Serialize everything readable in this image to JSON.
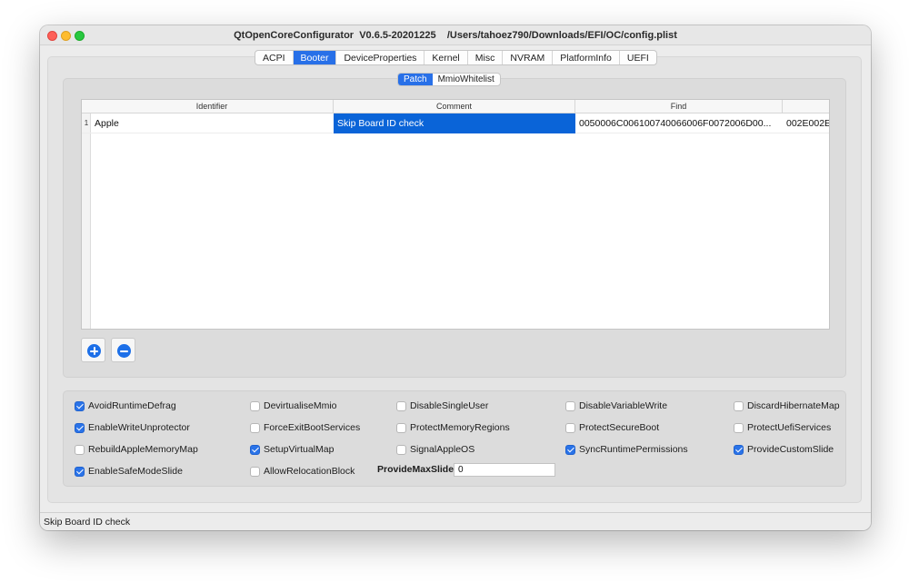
{
  "window": {
    "title": "QtOpenCoreConfigurator  V0.6.5-20201225    /Users/tahoez790/Downloads/EFI/OC/config.plist"
  },
  "tabs": [
    "ACPI",
    "Booter",
    "DeviceProperties",
    "Kernel",
    "Misc",
    "NVRAM",
    "PlatformInfo",
    "UEFI"
  ],
  "active_tab": "Booter",
  "subtabs": [
    "Patch",
    "MmioWhitelist"
  ],
  "active_subtab": "Patch",
  "table": {
    "columns": [
      "Identifier",
      "Comment",
      "Find",
      ""
    ],
    "rows": [
      {
        "num": "1",
        "identifier": "Apple",
        "comment": "Skip Board ID check",
        "find": "0050006C006100740066006F0072006D00...",
        "extra": "002E002E"
      }
    ]
  },
  "buttons": {
    "add_icon": "plus-circle-icon",
    "remove_icon": "minus-circle-icon"
  },
  "checkboxes": [
    {
      "label": "AvoidRuntimeDefrag",
      "checked": true
    },
    {
      "label": "DevirtualiseMmio",
      "checked": false
    },
    {
      "label": "DisableSingleUser",
      "checked": false
    },
    {
      "label": "DisableVariableWrite",
      "checked": false
    },
    {
      "label": "DiscardHibernateMap",
      "checked": false
    },
    {
      "label": "EnableWriteUnprotector",
      "checked": true
    },
    {
      "label": "ForceExitBootServices",
      "checked": false
    },
    {
      "label": "ProtectMemoryRegions",
      "checked": false
    },
    {
      "label": "ProtectSecureBoot",
      "checked": false
    },
    {
      "label": "ProtectUefiServices",
      "checked": false
    },
    {
      "label": "RebuildAppleMemoryMap",
      "checked": false
    },
    {
      "label": "SetupVirtualMap",
      "checked": true
    },
    {
      "label": "SignalAppleOS",
      "checked": false
    },
    {
      "label": "SyncRuntimePermissions",
      "checked": true
    },
    {
      "label": "ProvideCustomSlide",
      "checked": true
    },
    {
      "label": "EnableSafeModeSlide",
      "checked": true
    },
    {
      "label": "AllowRelocationBlock",
      "checked": false
    }
  ],
  "provide_max_slide": {
    "label": "ProvideMaxSlide",
    "value": "0"
  },
  "status": "Skip Board ID check",
  "colors": {
    "accent": "#2870e8",
    "selection": "#0a64d8",
    "window_bg": "#ececec"
  }
}
